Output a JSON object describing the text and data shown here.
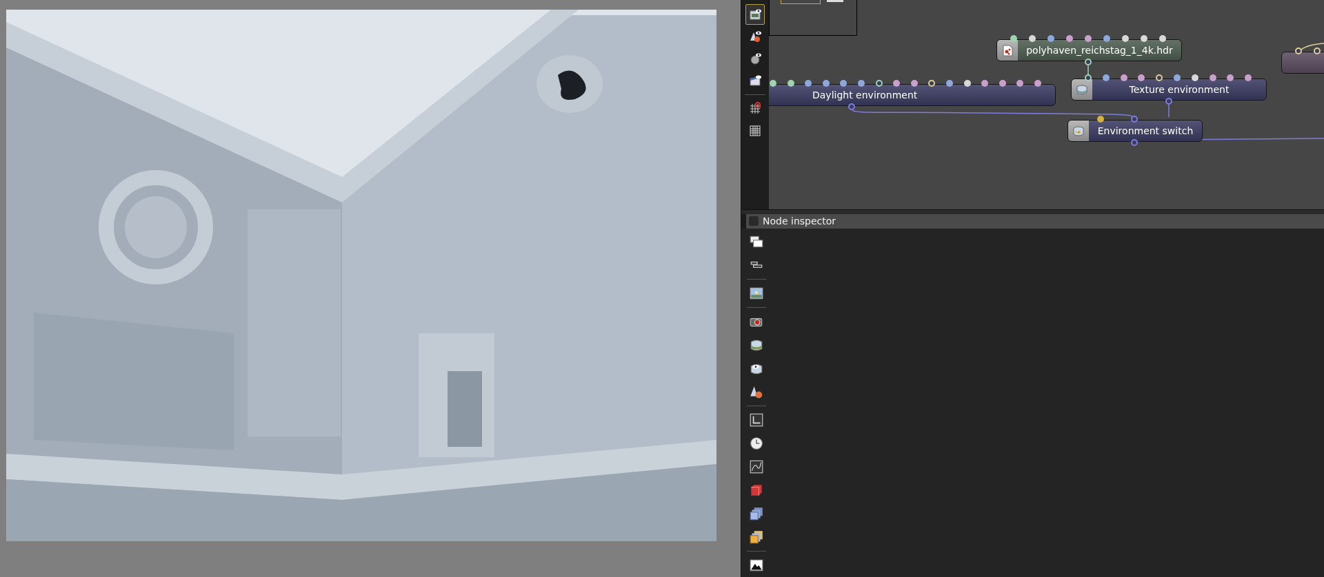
{
  "graph_toolbar": [
    {
      "selected": true
    },
    {
      "selected": false
    },
    {
      "selected": false
    },
    {
      "selected": false
    },
    {
      "selected": false
    },
    {
      "selected": false
    }
  ],
  "nodes": [
    {
      "label": "polyhaven_reichstag_1_4k.hdr",
      "color": "#4e5d50",
      "output": {
        "color": "#9fd4b0"
      },
      "ports": [
        {
          "color": "#9fd4b0",
          "kind": "filled"
        },
        {
          "color": "#d8d8d8",
          "kind": "filled"
        },
        {
          "color": "#8ea8dc",
          "kind": "filled"
        },
        {
          "color": "#c9a0cc",
          "kind": "filled"
        },
        {
          "color": "#c9a0cc",
          "kind": "filled"
        },
        {
          "color": "#8ea8dc",
          "kind": "filled"
        },
        {
          "color": "#d8d8d8",
          "kind": "filled"
        },
        {
          "color": "#d8d8d8",
          "kind": "filled"
        },
        {
          "color": "#d8d8d8",
          "kind": "filled"
        }
      ]
    },
    {
      "label": "Texture environment",
      "color": "#3b3b62",
      "output": {
        "color": "#7d7de0"
      },
      "ports": [
        {
          "color": "#9fd4b0",
          "kind": "hollow"
        },
        {
          "color": "#8ea8dc",
          "kind": "filled"
        },
        {
          "color": "#c9a0cc",
          "kind": "filled"
        },
        {
          "color": "#c9a0cc",
          "kind": "filled"
        },
        {
          "color": "#e0d090",
          "kind": "hollow"
        },
        {
          "color": "#8ea8dc",
          "kind": "filled"
        },
        {
          "color": "#d8d8d8",
          "kind": "filled"
        },
        {
          "color": "#c9a0cc",
          "kind": "filled"
        },
        {
          "color": "#c9a0cc",
          "kind": "filled"
        },
        {
          "color": "#c9a0cc",
          "kind": "filled"
        }
      ]
    },
    {
      "label": "Daylight environment",
      "color": "#3b3b62",
      "output": {
        "color": "#7d7de0"
      },
      "ports": [
        {
          "color": "#9fd4b0",
          "kind": "filled"
        },
        {
          "color": "#9fd4b0",
          "kind": "filled"
        },
        {
          "color": "#8ea8dc",
          "kind": "filled"
        },
        {
          "color": "#8ea8dc",
          "kind": "filled"
        },
        {
          "color": "#8ea8dc",
          "kind": "filled"
        },
        {
          "color": "#8ea8dc",
          "kind": "filled"
        },
        {
          "color": "#9fd4b0",
          "kind": "hollow"
        },
        {
          "color": "#c9a0cc",
          "kind": "filled"
        },
        {
          "color": "#c9a0cc",
          "kind": "filled"
        },
        {
          "color": "#e0d090",
          "kind": "hollow"
        },
        {
          "color": "#8ea8dc",
          "kind": "filled"
        },
        {
          "color": "#d8d8d8",
          "kind": "filled"
        },
        {
          "color": "#c9a0cc",
          "kind": "filled"
        },
        {
          "color": "#c9a0cc",
          "kind": "filled"
        },
        {
          "color": "#c9a0cc",
          "kind": "filled"
        },
        {
          "color": "#c9a0cc",
          "kind": "filled"
        }
      ]
    },
    {
      "label": "Environment switch",
      "color": "#3b3b62",
      "output": {
        "color": "#7d7de0"
      },
      "ports": [
        {
          "color": "#d4b040",
          "kind": "filled"
        },
        {
          "color": "#7d7de0",
          "kind": "hollow"
        }
      ]
    },
    {
      "color": "#5a4b5e",
      "ports": [
        {
          "color": "#e0d090",
          "kind": "hollow"
        },
        {
          "color": "#e0d090",
          "kind": "hollow"
        }
      ]
    }
  ],
  "inspector": {
    "title": "Node inspector"
  }
}
